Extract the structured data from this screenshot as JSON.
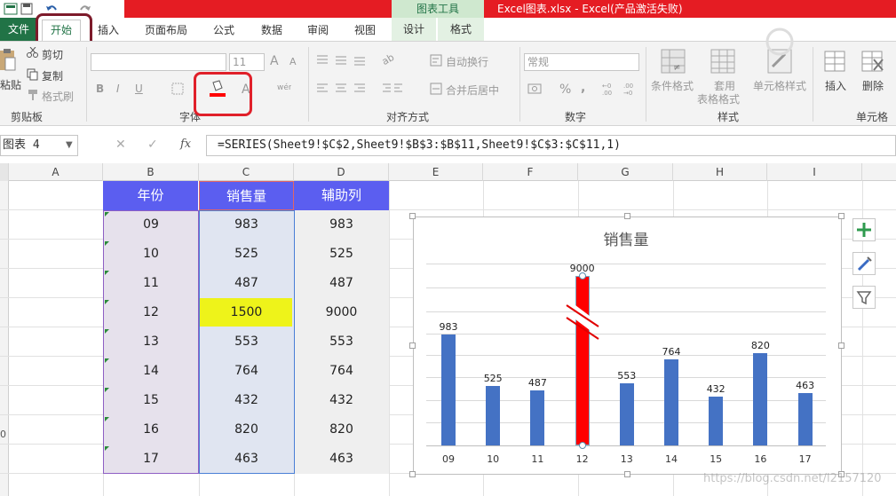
{
  "titlebar": {
    "chart_tools": "图表工具",
    "document": "Excel图表.xlsx - Excel(产品激活失败)"
  },
  "tabs": {
    "file": "文件",
    "home": "开始",
    "insert": "插入",
    "page_layout": "页面布局",
    "formulas": "公式",
    "data": "数据",
    "review": "审阅",
    "view": "视图",
    "design": "设计",
    "format": "格式"
  },
  "ribbon": {
    "clipboard": {
      "paste": "粘贴",
      "cut": "剪切",
      "copy": "复制",
      "format_painter": "格式刷",
      "label": "剪贴板"
    },
    "font": {
      "size": "11",
      "grow": "A",
      "shrink": "A",
      "bold": "B",
      "italic": "I",
      "underline": "U",
      "label": "字体"
    },
    "alignment": {
      "wrap": "自动换行",
      "merge": "合并后居中",
      "label": "对齐方式"
    },
    "number": {
      "format": "常规",
      "percent": "%",
      "comma": ",",
      "label": "数字"
    },
    "styles": {
      "conditional": "条件格式",
      "table_line1": "套用",
      "table_line2": "表格格式",
      "cell_styles": "单元格样式",
      "label": "样式"
    },
    "cells": {
      "insert": "插入",
      "delete": "删除",
      "label": "单元格"
    }
  },
  "formula_bar": {
    "name_box": "图表 4",
    "cancel": "✕",
    "enter": "✓",
    "fx": "fx",
    "formula": "=SERIES(Sheet9!$C$2,Sheet9!$B$3:$B$11,Sheet9!$C$3:$C$11,1)"
  },
  "sheet": {
    "columns": [
      "A",
      "B",
      "C",
      "D",
      "E",
      "F",
      "G",
      "H",
      "I"
    ],
    "row_label_partial": "0",
    "headers": {
      "year": "年份",
      "sales": "销售量",
      "helper": "辅助列"
    },
    "rows": [
      {
        "year": "09",
        "sales": "983",
        "helper": "983"
      },
      {
        "year": "10",
        "sales": "525",
        "helper": "525"
      },
      {
        "year": "11",
        "sales": "487",
        "helper": "487"
      },
      {
        "year": "12",
        "sales": "1500",
        "helper": "9000"
      },
      {
        "year": "13",
        "sales": "553",
        "helper": "553"
      },
      {
        "year": "14",
        "sales": "764",
        "helper": "764"
      },
      {
        "year": "15",
        "sales": "432",
        "helper": "432"
      },
      {
        "year": "16",
        "sales": "820",
        "helper": "820"
      },
      {
        "year": "17",
        "sales": "463",
        "helper": "463"
      }
    ],
    "highlight_color": "#eef31a",
    "header_color": "#5b5ef0"
  },
  "chart_data": {
    "type": "bar",
    "title": "销售量",
    "categories": [
      "09",
      "10",
      "11",
      "12",
      "13",
      "14",
      "15",
      "16",
      "17"
    ],
    "values": [
      983,
      525,
      487,
      9000,
      553,
      764,
      432,
      820,
      463
    ],
    "highlight_index": 3,
    "bar_color": "#4472c4",
    "highlight_color": "#ff0000",
    "axis_break": true,
    "grid": true,
    "xlabel": "",
    "ylabel": ""
  },
  "chart_buttons": {
    "add_element": "+",
    "styles": "brush",
    "filter": "filter"
  },
  "watermark": "https://blog.csdn.net/l2157120"
}
